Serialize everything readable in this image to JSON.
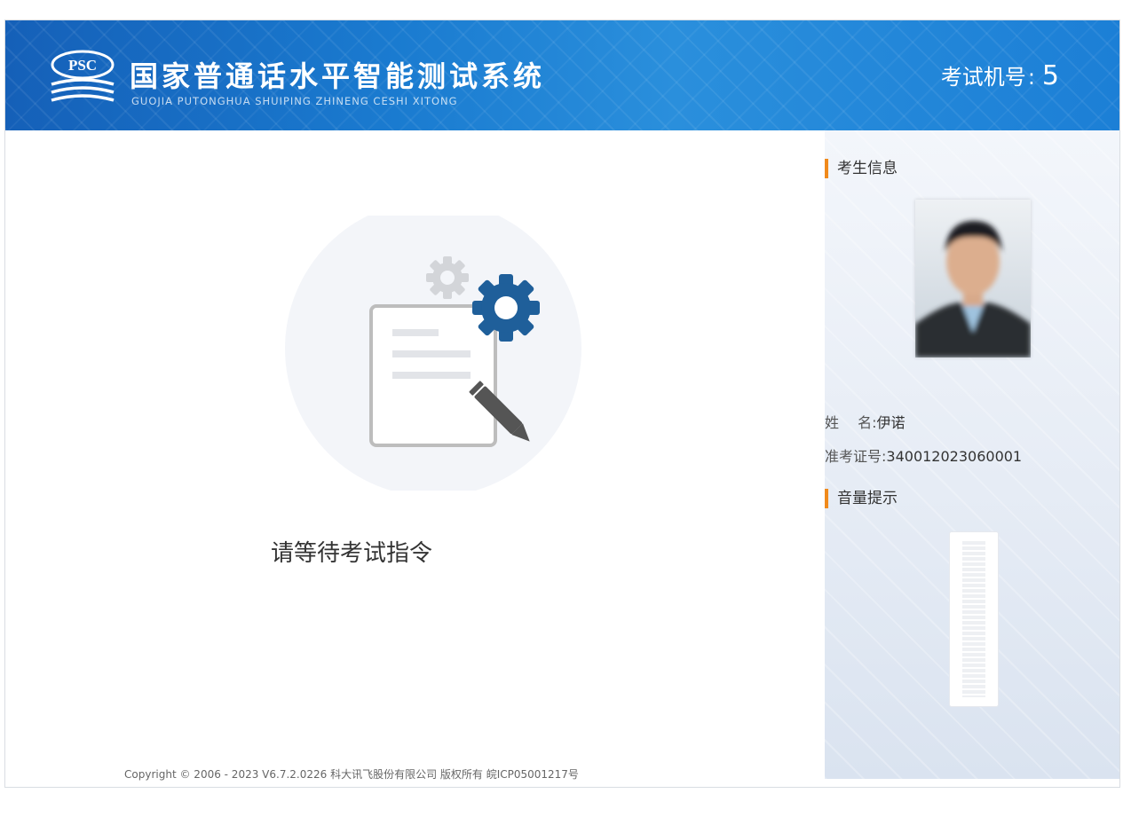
{
  "header": {
    "logo_text": "PSC",
    "title": "国家普通话水平智能测试系统",
    "subtitle": "GUOJIA PUTONGHUA SHUIPING ZHINENG CESHI XITONG",
    "machine_label": "考试机号",
    "machine_separator": ":",
    "machine_number": "5"
  },
  "main": {
    "illustration_icons": [
      "document-icon",
      "gear-icon",
      "gear-icon",
      "pencil-icon"
    ],
    "wait_message": "请等待考试指令",
    "copyright": "Copyright © 2006 - 2023 V6.7.2.0226 科大讯飞股份有限公司 版权所有 皖ICP05001217号"
  },
  "sidebar": {
    "candidate_section_title": "考生信息",
    "name_label": "姓　 名",
    "name_separator": ":",
    "name_value": "伊诺",
    "ticket_label": "准考证号",
    "ticket_separator": ":",
    "ticket_value": "340012023060001",
    "volume_section_title": "音量提示",
    "volume_level": 0
  },
  "colors": {
    "header_blue": "#1a7bd0",
    "accent_orange": "#f08a1c",
    "gear_blue": "#1f5f9a",
    "sidebar_bg": "#e6ecf5"
  }
}
